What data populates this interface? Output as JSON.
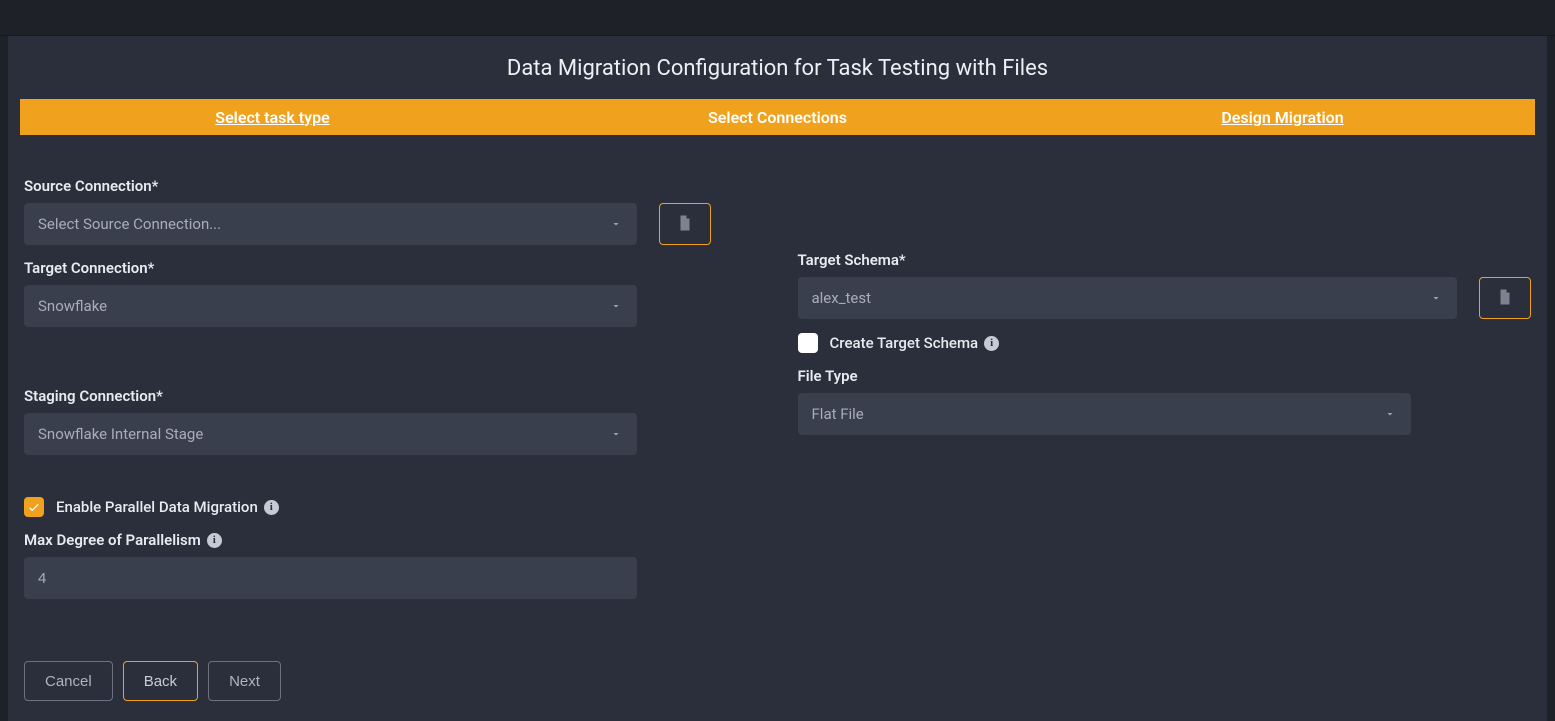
{
  "header": {
    "title": "Data Migration Configuration for Task Testing with Files"
  },
  "stepper": {
    "steps": [
      {
        "label": "Select task type"
      },
      {
        "label": "Select Connections"
      },
      {
        "label": "Design Migration"
      }
    ]
  },
  "form": {
    "source_connection": {
      "label": "Source Connection*",
      "placeholder": "Select Source Connection..."
    },
    "target_connection": {
      "label": "Target Connection*",
      "value": "Snowflake"
    },
    "target_schema": {
      "label": "Target Schema*",
      "value": "alex_test"
    },
    "create_target_schema": {
      "label": "Create Target Schema",
      "checked": false
    },
    "staging_connection": {
      "label": "Staging Connection*",
      "value": "Snowflake Internal Stage"
    },
    "file_type": {
      "label": "File Type",
      "value": "Flat File"
    },
    "enable_parallel": {
      "label": "Enable Parallel Data Migration",
      "checked": true
    },
    "max_parallelism": {
      "label": "Max Degree of Parallelism",
      "value": "4"
    }
  },
  "buttons": {
    "cancel": "Cancel",
    "back": "Back",
    "next": "Next"
  }
}
